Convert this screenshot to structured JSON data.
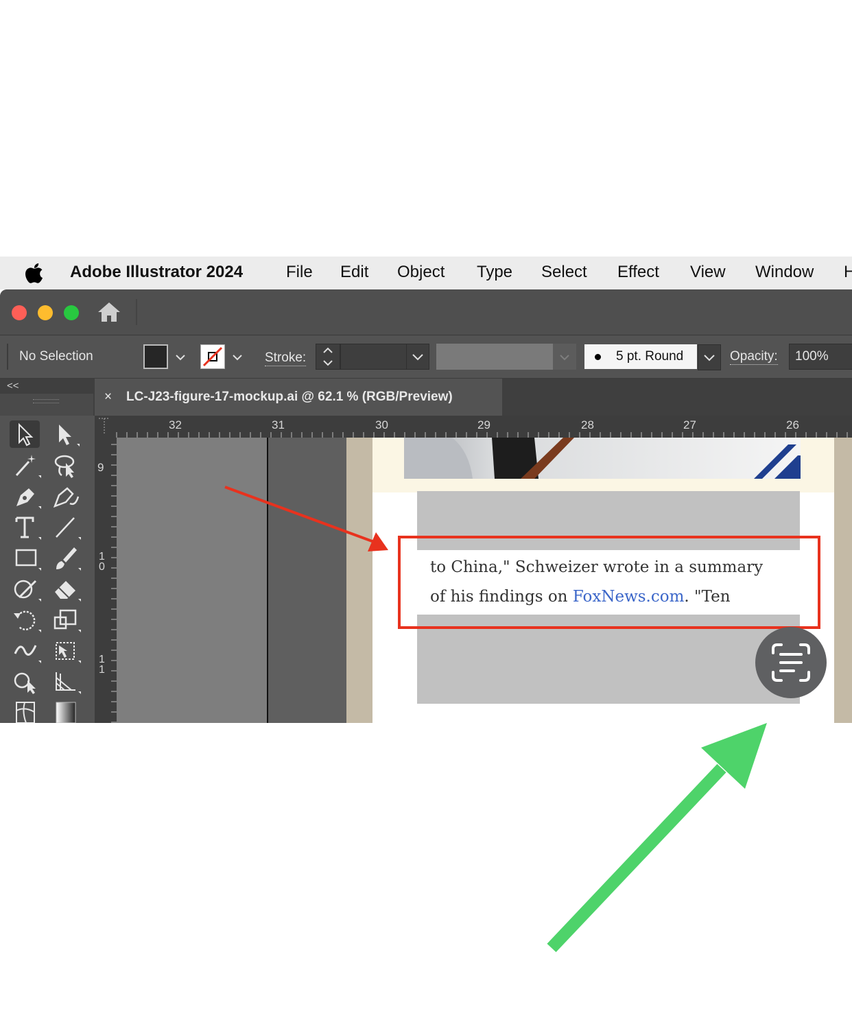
{
  "menubar": {
    "app_name": "Adobe Illustrator 2024",
    "items": [
      "File",
      "Edit",
      "Object",
      "Type",
      "Select",
      "Effect",
      "View",
      "Window",
      "H"
    ]
  },
  "controlbar": {
    "selection_label": "No Selection",
    "stroke_label": "Stroke:",
    "brush_value": "5 pt. Round",
    "opacity_label": "Opacity:",
    "opacity_value": "100%"
  },
  "document_tab": {
    "close_glyph": "×",
    "title": "LC-J23-figure-17-mockup.ai @ 62.1 % (RGB/Preview)"
  },
  "panel_toggle": "<<",
  "rulers": {
    "horizontal": [
      "32",
      "31",
      "30",
      "29",
      "28",
      "27",
      "26"
    ],
    "vertical": [
      "9",
      "1\n0",
      "1\n1"
    ]
  },
  "artboard": {
    "line1": "to China,\" Schweizer wrote in a summary",
    "line2_prefix": "of his findings on ",
    "line2_link": "FoxNews.com",
    "line2_suffix": ". \"Ten"
  },
  "icons": [
    "apple-icon",
    "home-icon",
    "close-icon",
    "selection-tool-icon",
    "direct-selection-tool-icon",
    "magic-wand-icon",
    "lasso-icon",
    "pen-tool-icon",
    "curvature-tool-icon",
    "type-tool-icon",
    "line-tool-icon",
    "rectangle-tool-icon",
    "paintbrush-icon",
    "shaper-tool-icon",
    "eraser-icon",
    "rotate-tool-icon",
    "scale-tool-icon",
    "width-tool-icon",
    "free-transform-icon",
    "shape-builder-icon",
    "perspective-grid-icon",
    "mesh-tool-icon",
    "gradient-tool-icon",
    "text-scan-icon"
  ],
  "colors": {
    "annotation_red": "#e8321e",
    "annotation_green": "#4ed36a",
    "link_blue": "#3b66c9",
    "traffic_red": "#fe5f57",
    "traffic_yellow": "#febc2e",
    "traffic_green": "#28c840"
  }
}
